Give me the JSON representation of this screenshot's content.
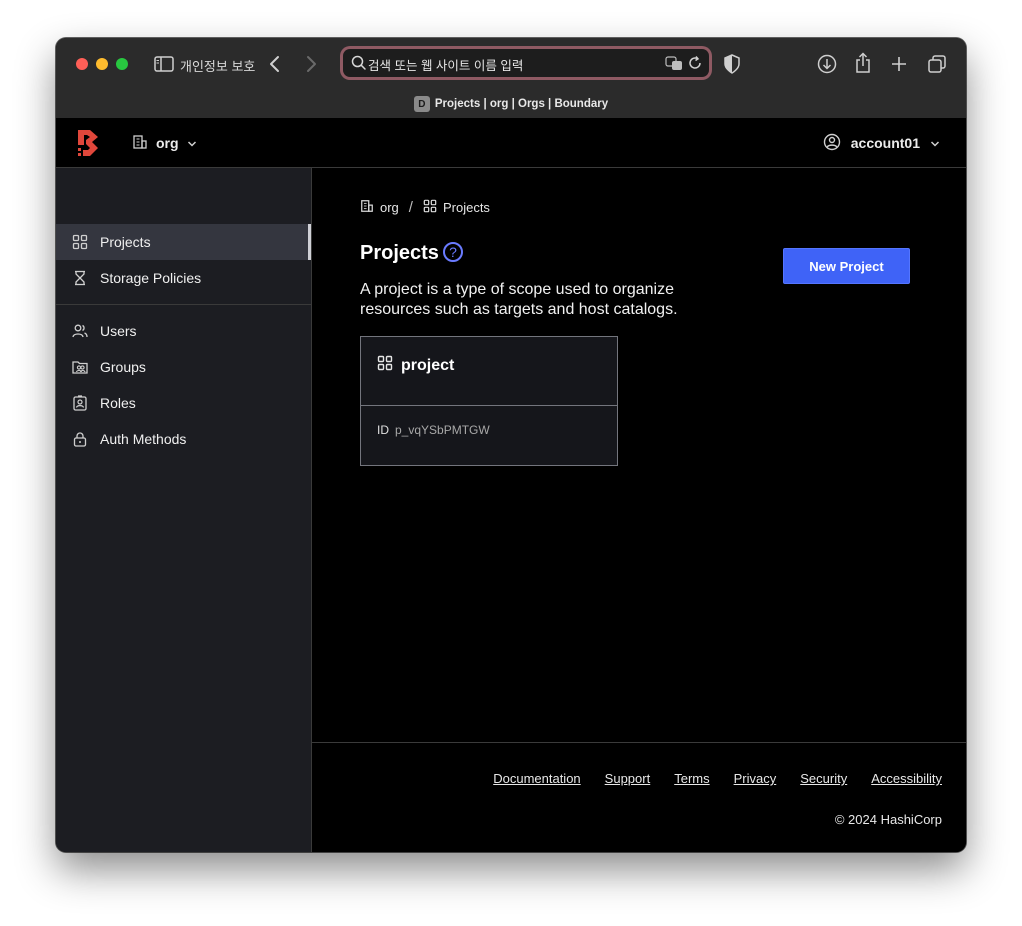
{
  "browser": {
    "privacy_label": "개인정보 보호",
    "address_placeholder": "검색 또는 웹 사이트 이름 입력",
    "tab_title": "Projects | org | Orgs | Boundary",
    "favicon_letter": "D"
  },
  "header": {
    "org_name": "org",
    "account_name": "account01"
  },
  "sidebar": {
    "items": [
      {
        "label": "Projects",
        "icon": "grid-icon",
        "active": true
      },
      {
        "label": "Storage Policies",
        "icon": "hourglass-icon"
      },
      {
        "label": "Users",
        "icon": "users-icon"
      },
      {
        "label": "Groups",
        "icon": "groups-icon"
      },
      {
        "label": "Roles",
        "icon": "id-badge-icon"
      },
      {
        "label": "Auth Methods",
        "icon": "lock-icon"
      }
    ]
  },
  "main": {
    "breadcrumb": {
      "org": "org",
      "sep": "/",
      "current": "Projects"
    },
    "title": "Projects",
    "help_glyph": "?",
    "description": "A project is a type of scope used to organize resources such as targets and host catalogs.",
    "new_button": "New Project",
    "card": {
      "name": "project",
      "id_label": "ID",
      "id_value": "p_vqYSbPMTGW"
    }
  },
  "footer": {
    "links": [
      "Documentation",
      "Support",
      "Terms",
      "Privacy",
      "Security",
      "Accessibility"
    ],
    "copyright": "© 2024 HashiCorp"
  },
  "colors": {
    "accent": "#3f63f7",
    "brand": "#e0473b",
    "sidebar_bg": "#1c1d22"
  }
}
